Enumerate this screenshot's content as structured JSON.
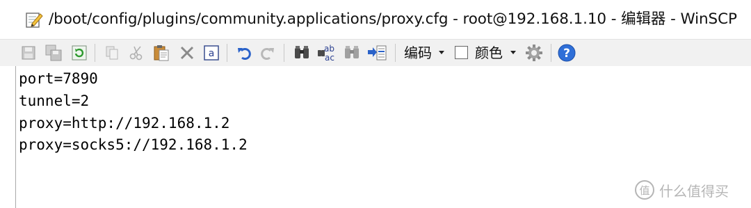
{
  "window": {
    "title": "/boot/config/plugins/community.applications/proxy.cfg - root@192.168.1.10 - 编辑器 - WinSCP"
  },
  "toolbar": {
    "buttons": [
      {
        "icon": "save-icon",
        "label": "Save"
      },
      {
        "icon": "save-all-icon",
        "label": "Save all"
      },
      {
        "icon": "reload-icon",
        "label": "Reload"
      },
      {
        "icon": "copy-icon",
        "label": "Copy"
      },
      {
        "icon": "cut-icon",
        "label": "Cut"
      },
      {
        "icon": "paste-icon",
        "label": "Paste"
      },
      {
        "icon": "delete-icon",
        "label": "Delete"
      },
      {
        "icon": "select-all-icon",
        "label": "Select all"
      },
      {
        "icon": "undo-icon",
        "label": "Undo"
      },
      {
        "icon": "redo-icon",
        "label": "Redo"
      },
      {
        "icon": "find-icon",
        "label": "Find"
      },
      {
        "icon": "replace-icon",
        "label": "Replace"
      },
      {
        "icon": "find-next-icon",
        "label": "Find next"
      },
      {
        "icon": "goto-line-icon",
        "label": "Go to line"
      },
      {
        "icon": "settings-icon",
        "label": "Preferences"
      },
      {
        "icon": "help-icon",
        "label": "Help"
      }
    ],
    "encoding_label": "编码",
    "color_label": "颜色"
  },
  "editor": {
    "lines": [
      "port=7890",
      "tunnel=2",
      "proxy=http://192.168.1.2",
      "proxy=socks5://192.168.1.2"
    ]
  },
  "watermark": {
    "text": "什么值得买",
    "logo_glyph": "值"
  },
  "colors": {
    "accent_blue": "#1a5fb4",
    "toolbar_bg": "#f1f1f1",
    "help_blue": "#2f6fd8",
    "undo_blue": "#2a62c9"
  }
}
